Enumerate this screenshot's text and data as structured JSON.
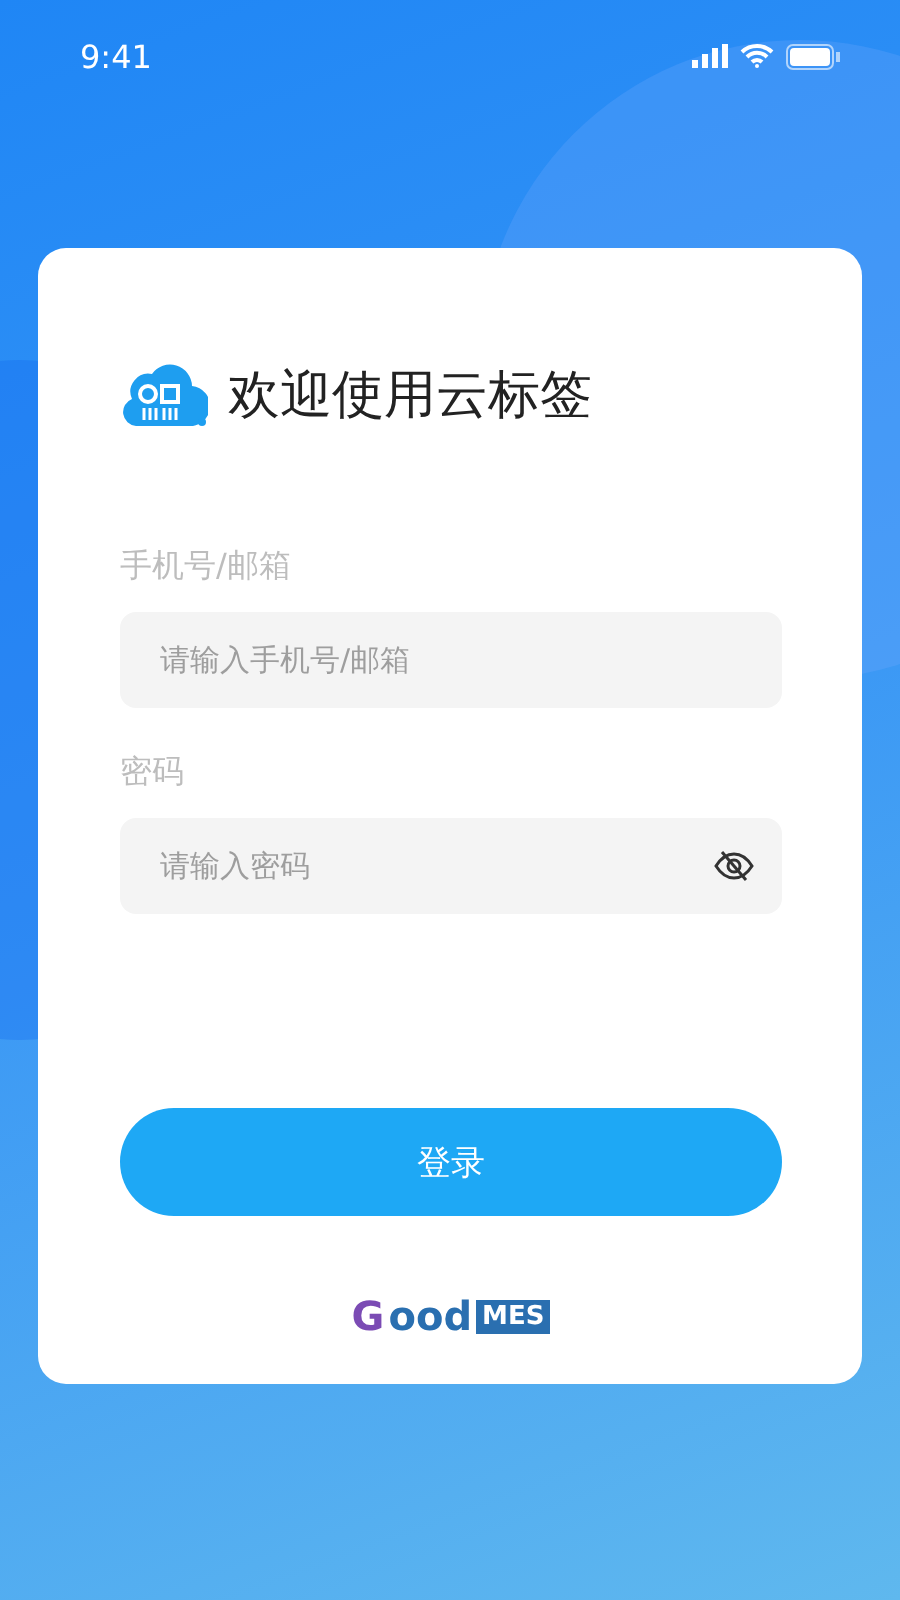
{
  "status_bar": {
    "time": "9:41"
  },
  "title": "欢迎使用云标签",
  "fields": [
    {
      "label": "手机号/邮箱",
      "placeholder": "请输入手机号/邮箱",
      "kind": "text"
    },
    {
      "label": "密码",
      "placeholder": "请输入密码",
      "kind": "password"
    }
  ],
  "login_button": "登录",
  "brand": {
    "first_letter": "G",
    "rest": "ood",
    "badge": "MES"
  }
}
